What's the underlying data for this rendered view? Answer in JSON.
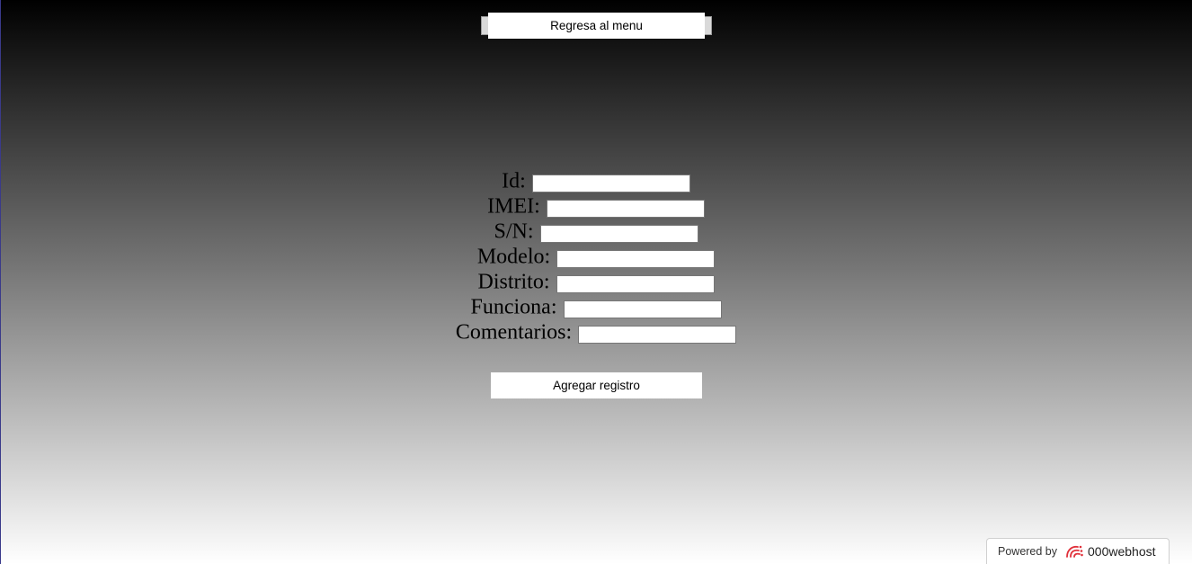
{
  "header": {
    "menu_button_label": "Regresa al menu"
  },
  "form": {
    "fields": [
      {
        "label": "Id:",
        "value": ""
      },
      {
        "label": "IMEI:",
        "value": ""
      },
      {
        "label": "S/N:",
        "value": ""
      },
      {
        "label": "Modelo:",
        "value": ""
      },
      {
        "label": "Distrito:",
        "value": ""
      },
      {
        "label": "Funciona:",
        "value": ""
      },
      {
        "label": "Comentarios:",
        "value": ""
      }
    ],
    "submit_label": "Agregar registro"
  },
  "footer": {
    "powered_by": "Powered by",
    "brand": "000webhost",
    "icon": "000webhost-logo-icon",
    "brand_color": "#e0303a"
  }
}
